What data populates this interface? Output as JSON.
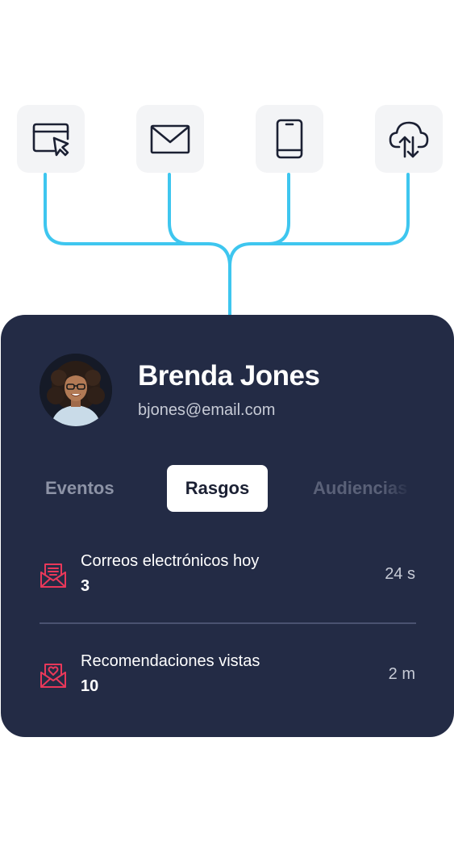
{
  "sources": [
    {
      "name": "web-browser-cursor-icon"
    },
    {
      "name": "email-envelope-icon"
    },
    {
      "name": "mobile-phone-icon"
    },
    {
      "name": "cloud-upload-download-icon"
    }
  ],
  "colors": {
    "connector": "#3ec6ef",
    "card_background": "#232b45",
    "trait_icon": "#e8385a",
    "tile_background": "#f3f4f6"
  },
  "profile": {
    "name": "Brenda Jones",
    "email": "bjones@email.com"
  },
  "tabs": {
    "events": "Eventos",
    "traits": "Rasgos",
    "audiences": "Audiencias",
    "active": "traits"
  },
  "traits": [
    {
      "label": "Correos electrónicos hoy",
      "value": "3",
      "time": "24 s",
      "icon": "envelope-letter-icon"
    },
    {
      "label": "Recomendaciones vistas",
      "value": "10",
      "time": "2 m",
      "icon": "envelope-heart-icon"
    }
  ]
}
